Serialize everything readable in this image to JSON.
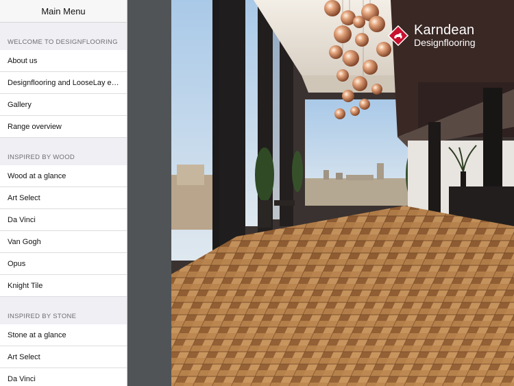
{
  "sidebar": {
    "title": "Main Menu",
    "sections": [
      {
        "header": "WELCOME TO DESIGNFLOORING",
        "items": [
          "About us",
          "Designflooring and LooseLay e…",
          "Gallery",
          "Range overview"
        ]
      },
      {
        "header": "INSPIRED BY WOOD",
        "items": [
          "Wood at a glance",
          "Art Select",
          "Da Vinci",
          "Van Gogh",
          "Opus",
          "Knight Tile"
        ]
      },
      {
        "header": "INSPIRED BY STONE",
        "items": [
          "Stone at a glance",
          "Art Select",
          "Da Vinci"
        ]
      }
    ]
  },
  "logo": {
    "brand": "Karndean",
    "sub": "Designflooring",
    "accent_color": "#c8102e",
    "icon": "dog-diamond-icon"
  },
  "hero": {
    "icon": "showroom-photo"
  }
}
